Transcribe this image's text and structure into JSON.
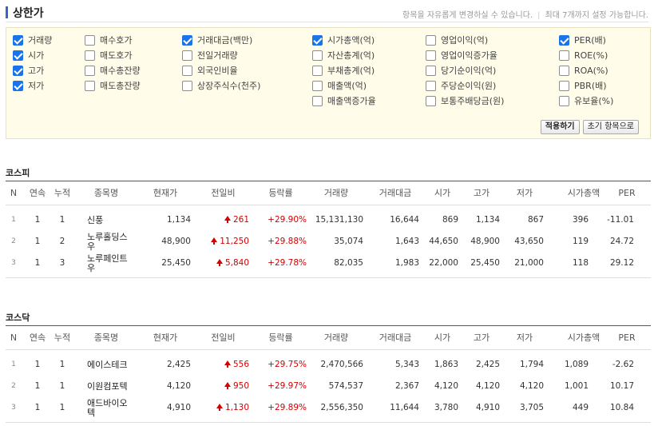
{
  "page": {
    "title": "상한가",
    "notice_left": "항목을 자유롭게 변경하실 수 있습니다.",
    "notice_separator": "|",
    "notice_right": "최대 7개까지 설정 가능합니다."
  },
  "options": {
    "items": [
      {
        "label": "거래량",
        "checked": true
      },
      {
        "label": "시가",
        "checked": true
      },
      {
        "label": "고가",
        "checked": true
      },
      {
        "label": "저가",
        "checked": true
      },
      {
        "label": "매수호가",
        "checked": false
      },
      {
        "label": "매도호가",
        "checked": false
      },
      {
        "label": "매수총잔량",
        "checked": false
      },
      {
        "label": "매도총잔량",
        "checked": false
      },
      {
        "label": "거래대금(백만)",
        "checked": true
      },
      {
        "label": "전일거래량",
        "checked": false
      },
      {
        "label": "외국인비율",
        "checked": false
      },
      {
        "label": "상장주식수(천주)",
        "checked": false
      },
      {
        "label": "시가총액(억)",
        "checked": true
      },
      {
        "label": "자산총계(억)",
        "checked": false
      },
      {
        "label": "부채총계(억)",
        "checked": false
      },
      {
        "label": "매출액(억)",
        "checked": false
      },
      {
        "label": "매출액증가율",
        "checked": false
      },
      {
        "label": "영업이익(억)",
        "checked": false
      },
      {
        "label": "영업이익증가율",
        "checked": false
      },
      {
        "label": "당기순이익(억)",
        "checked": false
      },
      {
        "label": "주당순이익(원)",
        "checked": false
      },
      {
        "label": "보통주배당금(원)",
        "checked": false
      },
      {
        "label": "PER(배)",
        "checked": true
      },
      {
        "label": "ROE(%)",
        "checked": false
      },
      {
        "label": "ROA(%)",
        "checked": false
      },
      {
        "label": "PBR(배)",
        "checked": false
      },
      {
        "label": "유보율(%)",
        "checked": false
      }
    ],
    "apply_label": "적용하기",
    "reset_label": "초기 항목으로"
  },
  "columns": [
    "N",
    "연속",
    "누적",
    "종목명",
    "현재가",
    "전일비",
    "등락률",
    "거래량",
    "거래대금",
    "시가",
    "고가",
    "저가",
    "시가총액",
    "PER"
  ],
  "sections": [
    {
      "title": "코스피",
      "rows": [
        {
          "n": "1",
          "streak": "1",
          "cum": "1",
          "name": "신풍",
          "price": "1,134",
          "change": "261",
          "rate": "+29.90%",
          "volume": "15,131,130",
          "amount": "16,644",
          "open": "869",
          "high": "1,134",
          "low": "867",
          "mcap": "396",
          "per": "-11.01"
        },
        {
          "n": "2",
          "streak": "1",
          "cum": "2",
          "name": "노루홀딩스우",
          "price": "48,900",
          "change": "11,250",
          "rate": "+29.88%",
          "volume": "35,074",
          "amount": "1,643",
          "open": "44,650",
          "high": "48,900",
          "low": "43,650",
          "mcap": "119",
          "per": "24.72"
        },
        {
          "n": "3",
          "streak": "1",
          "cum": "3",
          "name": "노루페인트우",
          "price": "25,450",
          "change": "5,840",
          "rate": "+29.78%",
          "volume": "82,035",
          "amount": "1,983",
          "open": "22,000",
          "high": "25,450",
          "low": "21,000",
          "mcap": "118",
          "per": "29.12"
        }
      ]
    },
    {
      "title": "코스닥",
      "rows": [
        {
          "n": "1",
          "streak": "1",
          "cum": "1",
          "name": "에이스테크",
          "price": "2,425",
          "change": "556",
          "rate": "+29.75%",
          "volume": "2,470,566",
          "amount": "5,343",
          "open": "1,863",
          "high": "2,425",
          "low": "1,794",
          "mcap": "1,089",
          "per": "-2.62"
        },
        {
          "n": "2",
          "streak": "1",
          "cum": "1",
          "name": "이원컴포텍",
          "price": "4,120",
          "change": "950",
          "rate": "+29.97%",
          "volume": "574,537",
          "amount": "2,367",
          "open": "4,120",
          "high": "4,120",
          "low": "4,120",
          "mcap": "1,001",
          "per": "10.17"
        },
        {
          "n": "3",
          "streak": "1",
          "cum": "1",
          "name": "애드바이오텍",
          "price": "4,910",
          "change": "1,130",
          "rate": "+29.89%",
          "volume": "2,556,350",
          "amount": "11,644",
          "open": "3,780",
          "high": "4,910",
          "low": "3,705",
          "mcap": "449",
          "per": "10.84"
        }
      ]
    }
  ],
  "colors": {
    "up": "#d40000",
    "accent": "#3a63c8",
    "check": "#1a73e8",
    "panel_bg": "#fffce9"
  }
}
